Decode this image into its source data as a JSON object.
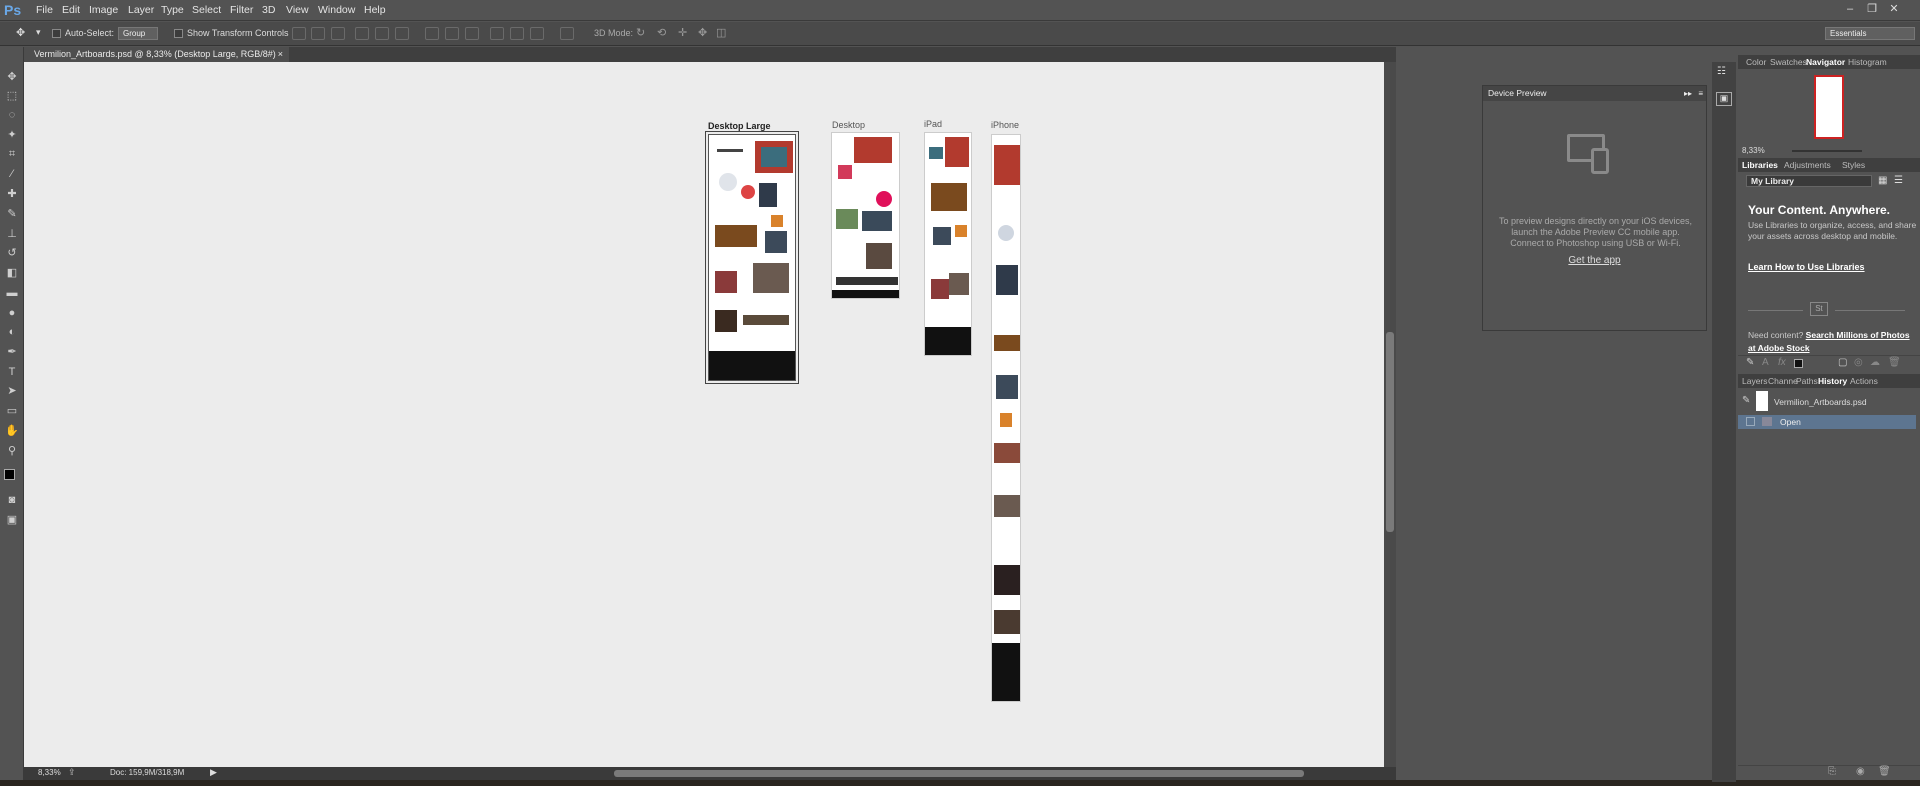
{
  "app": {
    "logo": "Ps"
  },
  "menu": [
    "File",
    "Edit",
    "Image",
    "Layer",
    "Type",
    "Select",
    "Filter",
    "3D",
    "View",
    "Window",
    "Help"
  ],
  "window_controls": {
    "minimize": "–",
    "restore": "❐",
    "close": "✕"
  },
  "options": {
    "auto_select_label": "Auto-Select:",
    "auto_select_value": "Group",
    "show_transform_label": "Show Transform Controls",
    "mode_3d_label": "3D Mode:",
    "workspace": "Essentials"
  },
  "document": {
    "tab_title": "Vermilion_Artboards.psd @ 8,33% (Desktop Large, RGB/8#)",
    "tab_close": "×"
  },
  "artboards": [
    {
      "label": "Desktop Large"
    },
    {
      "label": "Desktop"
    },
    {
      "label": "iPad"
    },
    {
      "label": "iPhone"
    }
  ],
  "status": {
    "zoom": "8,33%",
    "doc_info": "Doc: 159,9M/318,9M"
  },
  "device_preview": {
    "title": "Device Preview",
    "text": "To preview designs directly on your iOS devices, launch the Adobe Preview CC mobile app. Connect to Photoshop using USB or Wi-Fi.",
    "link": "Get the app"
  },
  "panels": {
    "top_tabs": [
      "Color",
      "Swatches",
      "Navigator",
      "Histogram"
    ],
    "navigator_zoom": "8,33%",
    "lib_tabs": [
      "Libraries",
      "Adjustments",
      "Styles"
    ],
    "library_select": "My Library",
    "lib_title": "Your Content. Anywhere.",
    "lib_desc": "Use Libraries to organize, access, and share your assets across desktop and mobile.",
    "lib_link": "Learn How to Use Libraries",
    "stock_badge": "St",
    "need_content": "Need content?",
    "stock_link": "Search Millions of Photos at Adobe Stock",
    "bottom_tabs": [
      "Layers",
      "Channe",
      "Paths",
      "History",
      "Actions"
    ],
    "history": [
      "Vermilion_Artboards.psd",
      "Open"
    ]
  }
}
